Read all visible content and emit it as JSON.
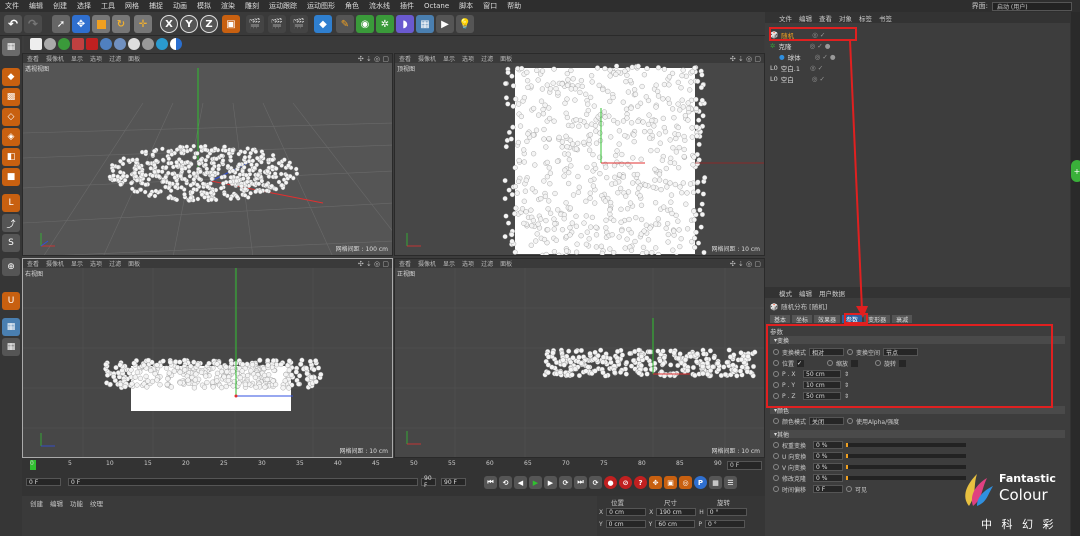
{
  "menubar": {
    "items": [
      "文件",
      "编辑",
      "创建",
      "选择",
      "工具",
      "网格",
      "捕捉",
      "动画",
      "模拟",
      "渲染",
      "雕刻",
      "运动跟踪",
      "运动图形",
      "角色",
      "流水线",
      "插件",
      "Octane",
      "脚本",
      "窗口",
      "帮助"
    ],
    "layout_label": "界面:",
    "layout_value": "启动 (用户)"
  },
  "toolbar": {
    "axis_x": "X",
    "axis_y": "Y",
    "axis_z": "Z"
  },
  "viewports": [
    {
      "name": "透视视图",
      "menu": [
        "查看",
        "摄像机",
        "显示",
        "选项",
        "过滤",
        "面板"
      ],
      "grid": "网格间距 : 100 cm"
    },
    {
      "name": "顶视图",
      "menu": [
        "查看",
        "摄像机",
        "显示",
        "选项",
        "过滤",
        "面板"
      ],
      "grid": "网格间距 : 10 cm"
    },
    {
      "name": "右视图",
      "menu": [
        "查看",
        "摄像机",
        "显示",
        "选项",
        "过滤",
        "面板"
      ],
      "grid": "网格间距 : 10 cm"
    },
    {
      "name": "正视图",
      "menu": [
        "查看",
        "摄像机",
        "显示",
        "选项",
        "过滤",
        "面板"
      ],
      "grid": "网格间距 : 10 cm"
    }
  ],
  "timeline": {
    "ticks": [
      "0",
      "5",
      "10",
      "15",
      "20",
      "25",
      "30",
      "35",
      "40",
      "45",
      "50",
      "55",
      "60",
      "65",
      "70",
      "75",
      "80",
      "85",
      "90"
    ],
    "current_frame": "0 F",
    "start": "0 F",
    "start2": "0 F",
    "end": "90 F",
    "end2": "90 F",
    "frame_right": "0 F"
  },
  "bottom": {
    "menu": [
      "创建",
      "编辑",
      "功能",
      "纹理"
    ],
    "coord_headers": [
      "位置",
      "尺寸",
      "旋转"
    ],
    "rows": [
      {
        "axis": "X",
        "pos": "0 cm",
        "axis2": "X",
        "size": "190 cm",
        "axis3": "H",
        "rot": "0 °"
      },
      {
        "axis": "Y",
        "pos": "0 cm",
        "axis2": "Y",
        "size": "60 cm",
        "axis3": "P",
        "rot": "0 °"
      }
    ]
  },
  "object_manager": {
    "menu": [
      "文件",
      "编辑",
      "查看",
      "对象",
      "标签",
      "书签"
    ],
    "objects": [
      {
        "name": "随机"
      },
      {
        "name": "克隆"
      },
      {
        "name": "球体"
      },
      {
        "name": "空白.1"
      },
      {
        "name": "空白"
      }
    ]
  },
  "attributes": {
    "menu": [
      "模式",
      "编辑",
      "用户数据"
    ],
    "title": "随机分布 [随机]",
    "tabs": [
      "基本",
      "坐标",
      "效果器",
      "参数",
      "变形器",
      "衰减"
    ],
    "active_tab": "参数",
    "params_title": "参数",
    "transform_section": "变换",
    "transform_mode_label": "变换模式",
    "transform_mode_value": "相对",
    "transform_space_label": "变换空间",
    "transform_space_value": "节点",
    "position_label": "位置",
    "scale_label": "缩放",
    "rotate_label": "旋转",
    "px_label": "P . X",
    "px_value": "50 cm",
    "py_label": "P . Y",
    "py_value": "10 cm",
    "pz_label": "P . Z",
    "pz_value": "50 cm",
    "color_section": "颜色",
    "color_mode_label": "颜色模式",
    "color_mode_value": "关闭",
    "use_alpha_label": "使用Alpha/强度",
    "other_section": "其他",
    "weight_label": "权重变换",
    "weight_value": "0 %",
    "u_label": "U 向变换",
    "u_value": "0 %",
    "v_label": "V 向变换",
    "v_value": "0 %",
    "mod_label": "修改克隆",
    "mod_value": "0 %",
    "time_label": "时间偏移",
    "time_value": "0 F",
    "visible_label": "可见"
  },
  "watermark": {
    "brand1": "Fantastic",
    "brand2": "Colour",
    "cn": "中 科 幻 彩"
  },
  "colors": {
    "accent_red": "#e02020",
    "tab_active": "#2c5fa0",
    "axis_x": "#e03030",
    "axis_y": "#30c030",
    "axis_z": "#3050e0"
  }
}
